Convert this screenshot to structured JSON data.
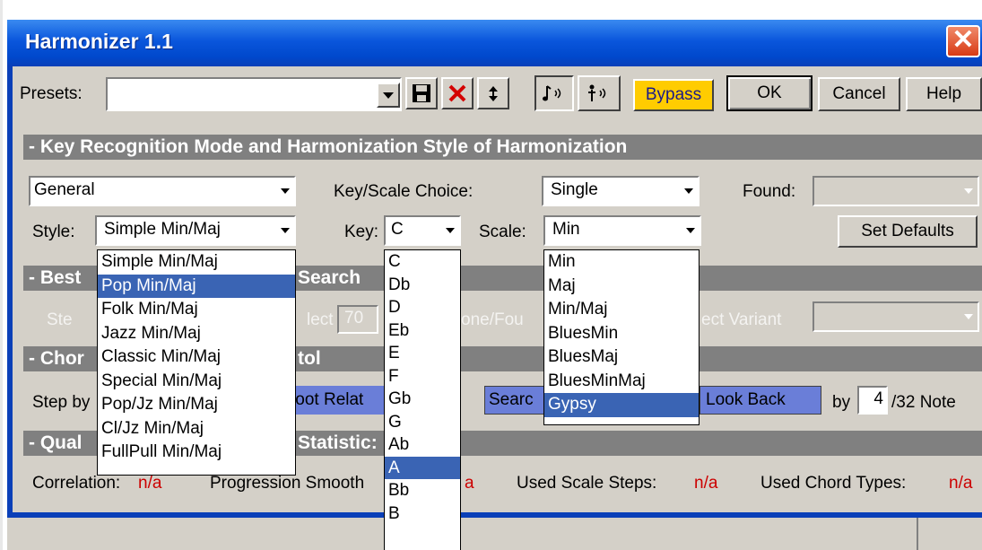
{
  "window": {
    "title": "Harmonizer 1.1",
    "close_glyph": "✕"
  },
  "toolbar": {
    "presets_label": "Presets:",
    "presets_value": "",
    "icons": [
      "save-icon",
      "delete-icon",
      "refresh-icon",
      "note-speaker-icon",
      "person-speaker-icon"
    ],
    "bypass_label": "Bypass",
    "ok_label": "OK",
    "cancel_label": "Cancel",
    "help_label": "Help",
    "bypass_color": "#ffcc00"
  },
  "sections": {
    "key_recognition": "- Key Recognition Mode and Harmonization Style of Harmonization",
    "best_search_a": "- Best",
    "best_search_b": "Search",
    "chord_a": "- Chor",
    "chord_b": "tol",
    "quality_a": "- Qual",
    "quality_b": "Statistic:"
  },
  "key": {
    "mode_value": "General",
    "scale_choice_label": "Key/Scale Choice:",
    "scale_choice_value": "Single",
    "found_label": "Found:",
    "found_value": "",
    "style_label": "Style:",
    "style_value": "Simple Min/Maj",
    "key_label": "Key:",
    "key_value": "C",
    "scale_label": "Scale:",
    "scale_value": "Min",
    "set_defaults_label": "Set Defaults"
  },
  "style_options": [
    "Simple Min/Maj",
    "Pop Min/Maj",
    "Folk Min/Maj",
    "Jazz Min/Maj",
    "Classic Min/Maj",
    "Special Min/Maj",
    "Pop/Jz Min/Maj",
    "Cl/Jz Min/Maj",
    "FullPull Min/Maj"
  ],
  "style_selected_index": 1,
  "key_options": [
    "C",
    "Db",
    "D",
    "Eb",
    "E",
    "F",
    "Gb",
    "G",
    "Ab",
    "A",
    "Bb",
    "B"
  ],
  "key_selected_index": 9,
  "scale_options": [
    "Min",
    "Maj",
    "Min/Maj",
    "BluesMin",
    "BluesMaj",
    "BluesMinMaj",
    "Gypsy"
  ],
  "scale_selected_index": 6,
  "best": {
    "ghost_1": "Ste",
    "ghost_2": "lect",
    "ghost_value": "70",
    "ghost_3": "one/Fou",
    "ghost_4": "ect Variant"
  },
  "chord": {
    "step_label": "Step by",
    "foot_rel": "foot Relat",
    "search_label": "Searc",
    "look_back": "Look Back",
    "by_label": "by",
    "note_value": "4",
    "note_suffix": "/32 Note"
  },
  "quality": {
    "correlation_label": "Correlation:",
    "correlation_value": "n/a",
    "smooth_label": "Progression Smooth",
    "smooth_value": "a",
    "scale_steps_label": "Used Scale Steps:",
    "scale_steps_value": "n/a",
    "chord_types_label": "Used Chord Types:",
    "chord_types_value": "n/a"
  }
}
